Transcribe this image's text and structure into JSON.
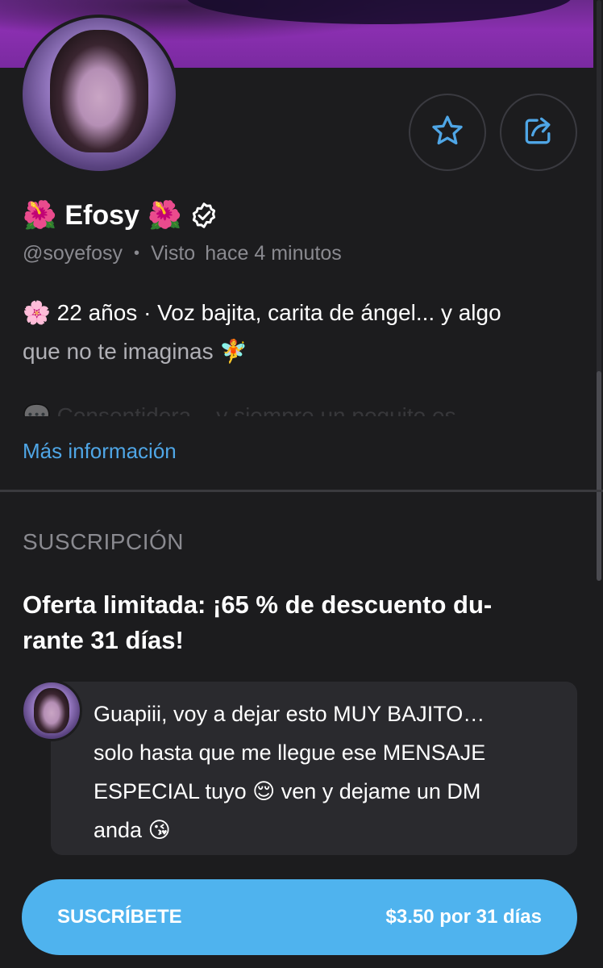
{
  "profile": {
    "name_prefix_emoji": "🌺",
    "name": "Efosy",
    "name_suffix_emoji": "🌺",
    "handle": "@soyefosy",
    "separator": "•",
    "seen_label": "Visto",
    "seen_time": "hace 4 minutos",
    "bio_line1": "🌸 22 años · Voz bajita, carita de ángel... y algo",
    "bio_line2": "que no te imaginas 🧚",
    "bio_line3_faded": "💬 Consentidora... y siempre un poquito es",
    "more_info": "Más información"
  },
  "actions": {
    "favorite_icon": "star-icon",
    "share_icon": "share-icon"
  },
  "subscription": {
    "section_title": "SUSCRIPCIÓN",
    "offer": "Oferta limitada: ¡65 % de descuento du-rante 31 días!",
    "offer_line1": "Oferta limitada: ¡65 % de descuento du-",
    "offer_line2": "rante 31 días!",
    "message_line1": "Guapiii, voy a dejar esto MUY BAJITO…",
    "message_line2": "solo hasta que me llegue ese MENSAJE",
    "message_line3": "ESPECIAL tuyo 😌 ven y dejame un DM",
    "message_line4": "anda 😘",
    "button_label": "SUSCRÍBETE",
    "button_price": "$3.50 por 31 días"
  },
  "colors": {
    "background": "#1c1c1e",
    "accent": "#4fb3ee",
    "link": "#4fa6e6",
    "muted": "#8a8a90",
    "card": "#2a2a2e"
  }
}
